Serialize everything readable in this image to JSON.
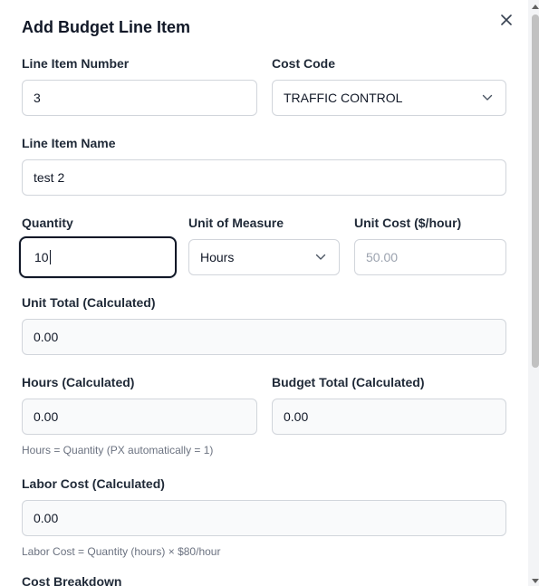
{
  "modal": {
    "title": "Add Budget Line Item",
    "close_icon": "close-icon"
  },
  "fields": {
    "line_item_number": {
      "label": "Line Item Number",
      "value": "3"
    },
    "cost_code": {
      "label": "Cost Code",
      "value": "TRAFFIC CONTROL"
    },
    "line_item_name": {
      "label": "Line Item Name",
      "value": "test 2"
    },
    "quantity": {
      "label": "Quantity",
      "value": "10"
    },
    "unit_of_measure": {
      "label": "Unit of Measure",
      "value": "Hours"
    },
    "unit_cost": {
      "label": "Unit Cost ($/hour)",
      "placeholder": "50.00"
    },
    "unit_total": {
      "label": "Unit Total (Calculated)",
      "value": "0.00"
    },
    "hours": {
      "label": "Hours (Calculated)",
      "value": "0.00",
      "help": "Hours = Quantity (PX automatically = 1)"
    },
    "budget_total": {
      "label": "Budget Total (Calculated)",
      "value": "0.00"
    },
    "labor_cost": {
      "label": "Labor Cost (Calculated)",
      "value": "0.00",
      "help": "Labor Cost = Quantity (hours) × $80/hour"
    }
  },
  "sections": {
    "cost_breakdown": "Cost Breakdown"
  },
  "colors": {
    "text": "#111827",
    "border": "#d1d5db",
    "readonly_bg": "#f9fafb",
    "muted": "#6b7280"
  }
}
